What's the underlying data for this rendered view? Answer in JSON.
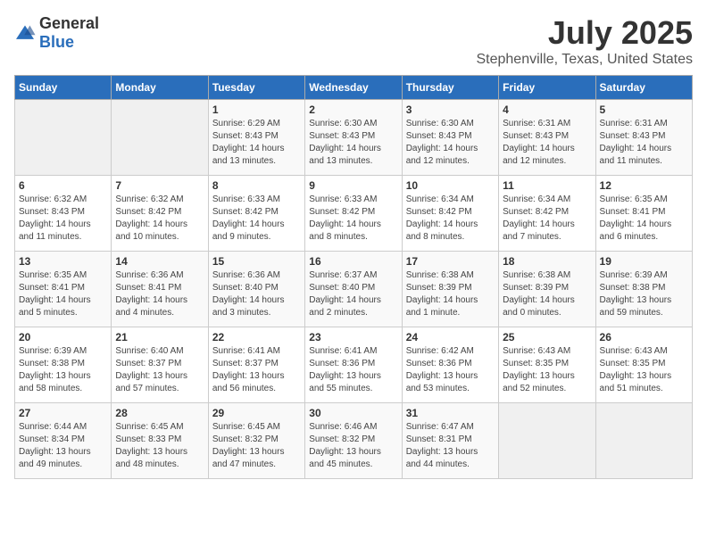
{
  "header": {
    "logo_general": "General",
    "logo_blue": "Blue",
    "month": "July 2025",
    "location": "Stephenville, Texas, United States"
  },
  "days_of_week": [
    "Sunday",
    "Monday",
    "Tuesday",
    "Wednesday",
    "Thursday",
    "Friday",
    "Saturday"
  ],
  "weeks": [
    [
      {
        "day": "",
        "detail": ""
      },
      {
        "day": "",
        "detail": ""
      },
      {
        "day": "1",
        "detail": "Sunrise: 6:29 AM\nSunset: 8:43 PM\nDaylight: 14 hours\nand 13 minutes."
      },
      {
        "day": "2",
        "detail": "Sunrise: 6:30 AM\nSunset: 8:43 PM\nDaylight: 14 hours\nand 13 minutes."
      },
      {
        "day": "3",
        "detail": "Sunrise: 6:30 AM\nSunset: 8:43 PM\nDaylight: 14 hours\nand 12 minutes."
      },
      {
        "day": "4",
        "detail": "Sunrise: 6:31 AM\nSunset: 8:43 PM\nDaylight: 14 hours\nand 12 minutes."
      },
      {
        "day": "5",
        "detail": "Sunrise: 6:31 AM\nSunset: 8:43 PM\nDaylight: 14 hours\nand 11 minutes."
      }
    ],
    [
      {
        "day": "6",
        "detail": "Sunrise: 6:32 AM\nSunset: 8:43 PM\nDaylight: 14 hours\nand 11 minutes."
      },
      {
        "day": "7",
        "detail": "Sunrise: 6:32 AM\nSunset: 8:42 PM\nDaylight: 14 hours\nand 10 minutes."
      },
      {
        "day": "8",
        "detail": "Sunrise: 6:33 AM\nSunset: 8:42 PM\nDaylight: 14 hours\nand 9 minutes."
      },
      {
        "day": "9",
        "detail": "Sunrise: 6:33 AM\nSunset: 8:42 PM\nDaylight: 14 hours\nand 8 minutes."
      },
      {
        "day": "10",
        "detail": "Sunrise: 6:34 AM\nSunset: 8:42 PM\nDaylight: 14 hours\nand 8 minutes."
      },
      {
        "day": "11",
        "detail": "Sunrise: 6:34 AM\nSunset: 8:42 PM\nDaylight: 14 hours\nand 7 minutes."
      },
      {
        "day": "12",
        "detail": "Sunrise: 6:35 AM\nSunset: 8:41 PM\nDaylight: 14 hours\nand 6 minutes."
      }
    ],
    [
      {
        "day": "13",
        "detail": "Sunrise: 6:35 AM\nSunset: 8:41 PM\nDaylight: 14 hours\nand 5 minutes."
      },
      {
        "day": "14",
        "detail": "Sunrise: 6:36 AM\nSunset: 8:41 PM\nDaylight: 14 hours\nand 4 minutes."
      },
      {
        "day": "15",
        "detail": "Sunrise: 6:36 AM\nSunset: 8:40 PM\nDaylight: 14 hours\nand 3 minutes."
      },
      {
        "day": "16",
        "detail": "Sunrise: 6:37 AM\nSunset: 8:40 PM\nDaylight: 14 hours\nand 2 minutes."
      },
      {
        "day": "17",
        "detail": "Sunrise: 6:38 AM\nSunset: 8:39 PM\nDaylight: 14 hours\nand 1 minute."
      },
      {
        "day": "18",
        "detail": "Sunrise: 6:38 AM\nSunset: 8:39 PM\nDaylight: 14 hours\nand 0 minutes."
      },
      {
        "day": "19",
        "detail": "Sunrise: 6:39 AM\nSunset: 8:38 PM\nDaylight: 13 hours\nand 59 minutes."
      }
    ],
    [
      {
        "day": "20",
        "detail": "Sunrise: 6:39 AM\nSunset: 8:38 PM\nDaylight: 13 hours\nand 58 minutes."
      },
      {
        "day": "21",
        "detail": "Sunrise: 6:40 AM\nSunset: 8:37 PM\nDaylight: 13 hours\nand 57 minutes."
      },
      {
        "day": "22",
        "detail": "Sunrise: 6:41 AM\nSunset: 8:37 PM\nDaylight: 13 hours\nand 56 minutes."
      },
      {
        "day": "23",
        "detail": "Sunrise: 6:41 AM\nSunset: 8:36 PM\nDaylight: 13 hours\nand 55 minutes."
      },
      {
        "day": "24",
        "detail": "Sunrise: 6:42 AM\nSunset: 8:36 PM\nDaylight: 13 hours\nand 53 minutes."
      },
      {
        "day": "25",
        "detail": "Sunrise: 6:43 AM\nSunset: 8:35 PM\nDaylight: 13 hours\nand 52 minutes."
      },
      {
        "day": "26",
        "detail": "Sunrise: 6:43 AM\nSunset: 8:35 PM\nDaylight: 13 hours\nand 51 minutes."
      }
    ],
    [
      {
        "day": "27",
        "detail": "Sunrise: 6:44 AM\nSunset: 8:34 PM\nDaylight: 13 hours\nand 49 minutes."
      },
      {
        "day": "28",
        "detail": "Sunrise: 6:45 AM\nSunset: 8:33 PM\nDaylight: 13 hours\nand 48 minutes."
      },
      {
        "day": "29",
        "detail": "Sunrise: 6:45 AM\nSunset: 8:32 PM\nDaylight: 13 hours\nand 47 minutes."
      },
      {
        "day": "30",
        "detail": "Sunrise: 6:46 AM\nSunset: 8:32 PM\nDaylight: 13 hours\nand 45 minutes."
      },
      {
        "day": "31",
        "detail": "Sunrise: 6:47 AM\nSunset: 8:31 PM\nDaylight: 13 hours\nand 44 minutes."
      },
      {
        "day": "",
        "detail": ""
      },
      {
        "day": "",
        "detail": ""
      }
    ]
  ]
}
